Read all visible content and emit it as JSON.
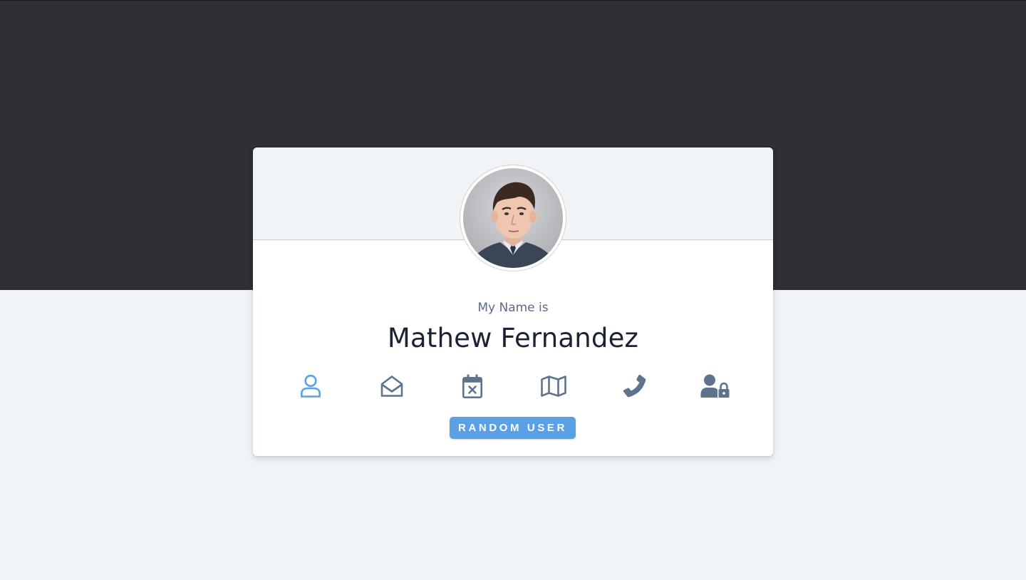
{
  "profile": {
    "label": "My Name is",
    "value": "Mathew Fernandez",
    "avatar_icon": "user-portrait"
  },
  "icons": [
    {
      "name": "user-icon",
      "active": true
    },
    {
      "name": "envelope-open-icon",
      "active": false
    },
    {
      "name": "calendar-x-icon",
      "active": false
    },
    {
      "name": "map-icon",
      "active": false
    },
    {
      "name": "phone-icon",
      "active": false
    },
    {
      "name": "user-lock-icon",
      "active": false
    }
  ],
  "button": {
    "label": "RANDOM USER"
  },
  "colors": {
    "top_band": "#2e3035",
    "page_background": "#f0f4f8",
    "active_icon": "#5ba0e5",
    "inactive_icon": "#5f738d",
    "button": "#5ba0e5",
    "name_text": "#1b2236",
    "label_text": "#5b6b82"
  }
}
